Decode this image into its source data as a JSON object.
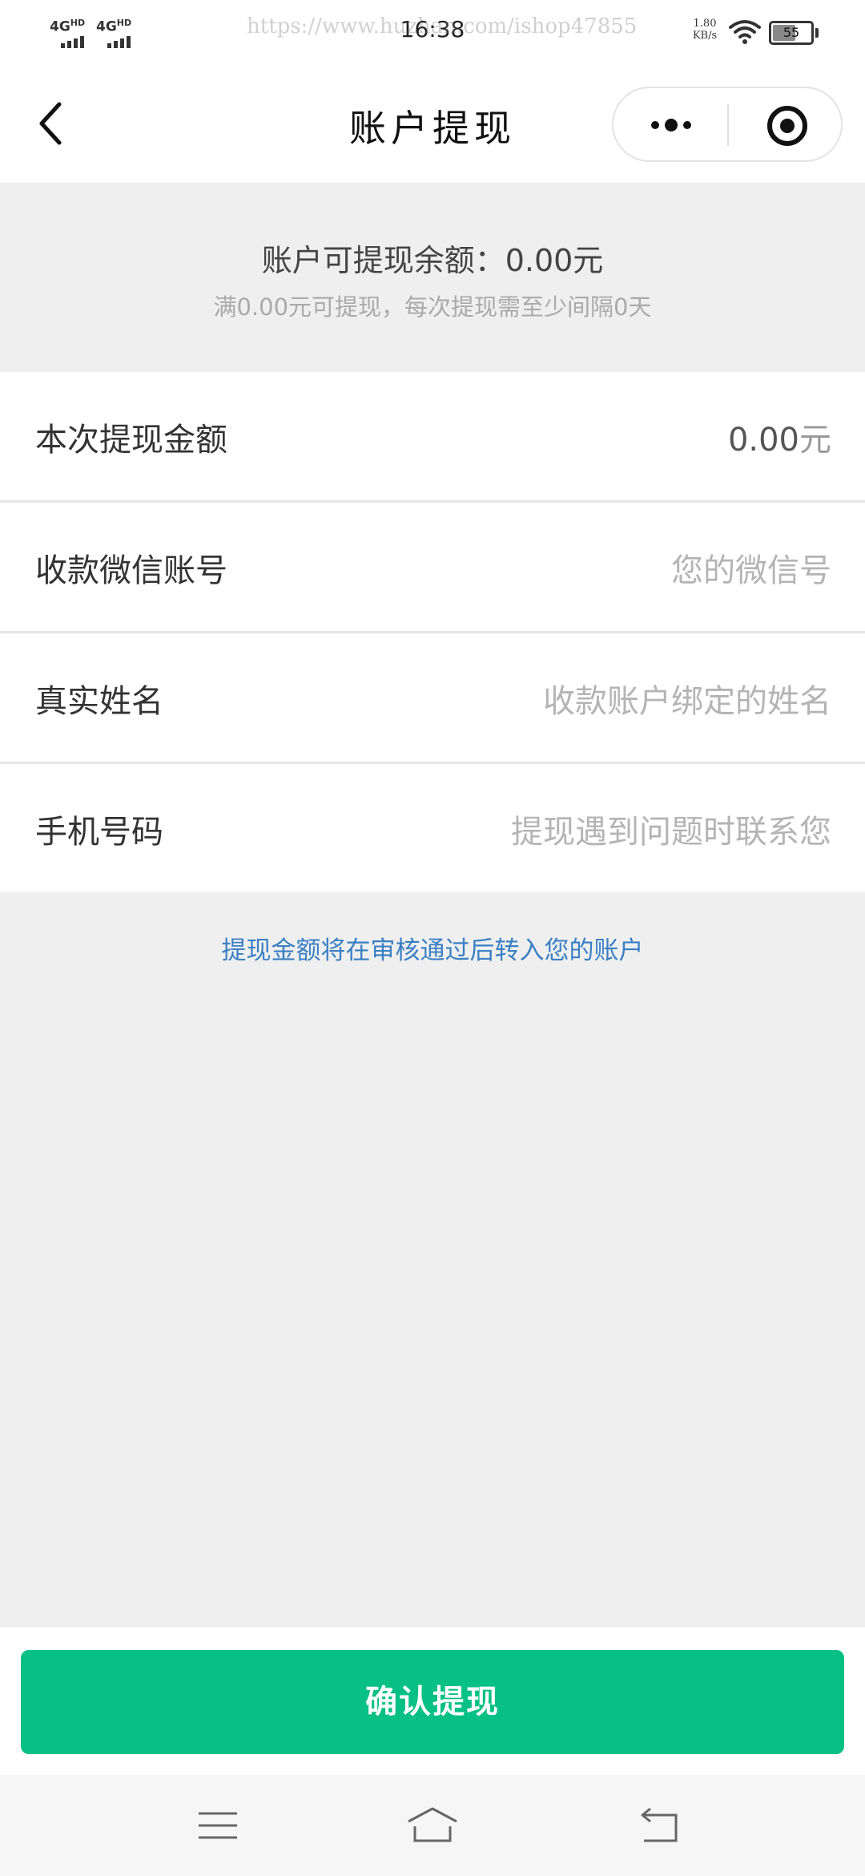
{
  "status_bar": {
    "signal_1": "4G",
    "signal_1_sup": "HD",
    "signal_2": "4G",
    "signal_2_sup": "HD",
    "time": "16:38",
    "watermark": "https://www.huzhan.com/ishop47855",
    "net_speed_value": "1.80",
    "net_speed_unit": "KB/s",
    "battery_level": "55",
    "icons": [
      "signal-icon",
      "wifi-icon",
      "battery-icon"
    ]
  },
  "nav": {
    "title": "账户提现",
    "icons": [
      "back-icon",
      "more-icon",
      "target-icon"
    ]
  },
  "balance": {
    "title": "账户可提现余额：0.00元",
    "note": "满0.00元可提现，每次提现需至少间隔0天"
  },
  "form": {
    "amount": {
      "label": "本次提现金额",
      "value": "0.00",
      "unit": "元"
    },
    "wechat": {
      "label": "收款微信账号",
      "placeholder": "您的微信号"
    },
    "name": {
      "label": "真实姓名",
      "placeholder": "收款账户绑定的姓名"
    },
    "phone": {
      "label": "手机号码",
      "placeholder": "提现遇到问题时联系您"
    }
  },
  "tip": "提现金额将在审核通过后转入您的账户",
  "confirm_button": "确认提现",
  "system_nav": {
    "icons": [
      "menu-icon",
      "home-icon",
      "return-icon"
    ]
  },
  "colors": {
    "accent": "#07c083",
    "link": "#3a7fc4",
    "page_bg": "#efeff0",
    "placeholder": "#b4b4b4"
  }
}
